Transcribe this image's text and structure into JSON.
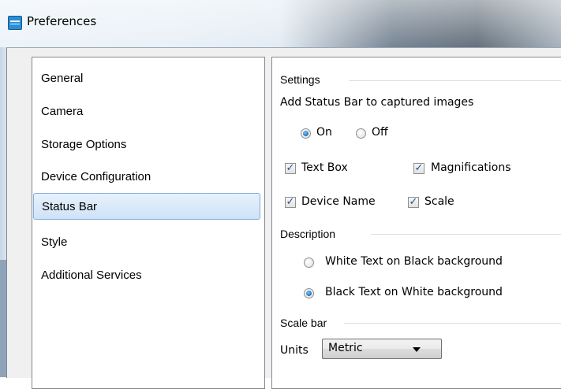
{
  "window": {
    "title": "Preferences",
    "icon": "preferences-app-icon"
  },
  "nav": {
    "items": [
      {
        "label": "General"
      },
      {
        "label": "Camera"
      },
      {
        "label": "Storage Options"
      },
      {
        "label": "Device Configuration"
      },
      {
        "label": "Status Bar",
        "selected": true
      },
      {
        "label": "Style"
      },
      {
        "label": "Additional Services"
      }
    ]
  },
  "settings": {
    "group_title": "Settings",
    "add_status_bar_label": "Add Status Bar to captured images",
    "on_label": "On",
    "off_label": "Off",
    "on_selected": true,
    "checkboxes": [
      {
        "label": "Text Box",
        "checked": true
      },
      {
        "label": "Magnifications",
        "checked": true
      },
      {
        "label": "Device Name",
        "checked": true
      },
      {
        "label": "Scale",
        "checked": true
      }
    ],
    "check_glyph": "✓"
  },
  "description": {
    "group_title": "Description",
    "options": [
      {
        "label": "White Text on Black background",
        "selected": false
      },
      {
        "label": "Black Text on White background",
        "selected": true
      }
    ]
  },
  "scale_bar": {
    "group_title": "Scale bar",
    "units_label": "Units",
    "units_value": "Metric"
  }
}
